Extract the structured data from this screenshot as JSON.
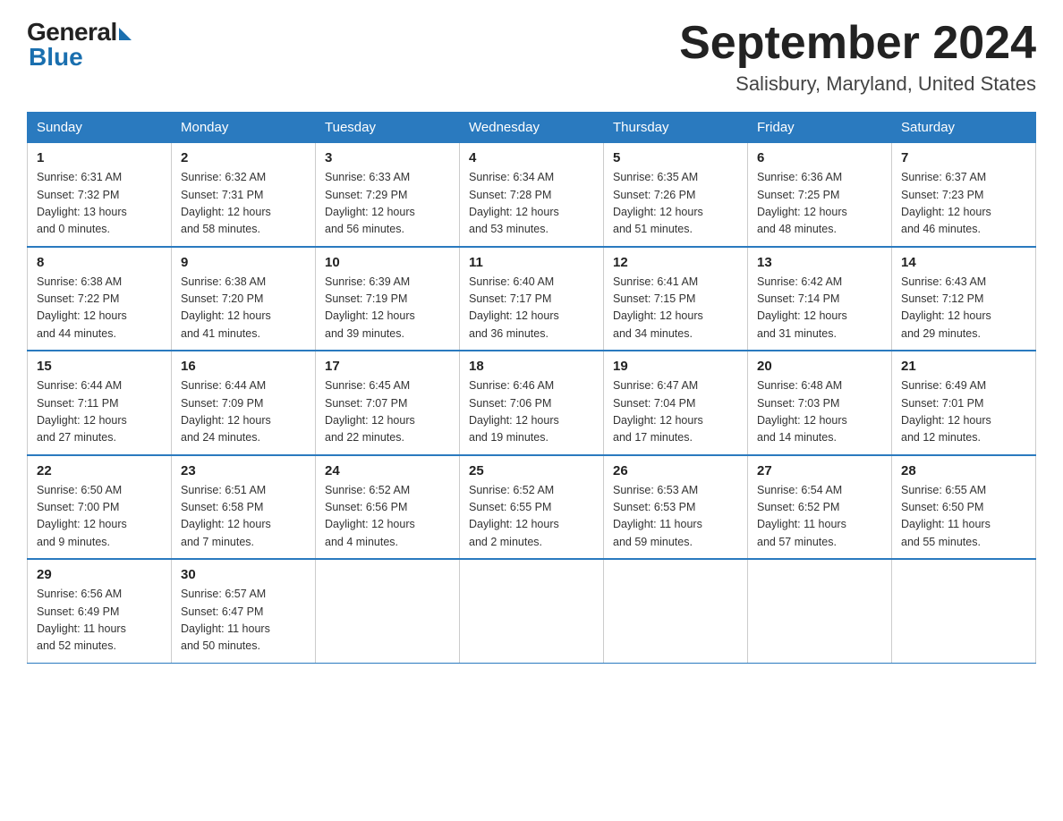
{
  "header": {
    "logo_general": "General",
    "logo_blue": "Blue",
    "title": "September 2024",
    "location": "Salisbury, Maryland, United States"
  },
  "weekdays": [
    "Sunday",
    "Monday",
    "Tuesday",
    "Wednesday",
    "Thursday",
    "Friday",
    "Saturday"
  ],
  "weeks": [
    [
      {
        "day": "1",
        "sunrise": "6:31 AM",
        "sunset": "7:32 PM",
        "daylight": "13 hours and 0 minutes."
      },
      {
        "day": "2",
        "sunrise": "6:32 AM",
        "sunset": "7:31 PM",
        "daylight": "12 hours and 58 minutes."
      },
      {
        "day": "3",
        "sunrise": "6:33 AM",
        "sunset": "7:29 PM",
        "daylight": "12 hours and 56 minutes."
      },
      {
        "day": "4",
        "sunrise": "6:34 AM",
        "sunset": "7:28 PM",
        "daylight": "12 hours and 53 minutes."
      },
      {
        "day": "5",
        "sunrise": "6:35 AM",
        "sunset": "7:26 PM",
        "daylight": "12 hours and 51 minutes."
      },
      {
        "day": "6",
        "sunrise": "6:36 AM",
        "sunset": "7:25 PM",
        "daylight": "12 hours and 48 minutes."
      },
      {
        "day": "7",
        "sunrise": "6:37 AM",
        "sunset": "7:23 PM",
        "daylight": "12 hours and 46 minutes."
      }
    ],
    [
      {
        "day": "8",
        "sunrise": "6:38 AM",
        "sunset": "7:22 PM",
        "daylight": "12 hours and 44 minutes."
      },
      {
        "day": "9",
        "sunrise": "6:38 AM",
        "sunset": "7:20 PM",
        "daylight": "12 hours and 41 minutes."
      },
      {
        "day": "10",
        "sunrise": "6:39 AM",
        "sunset": "7:19 PM",
        "daylight": "12 hours and 39 minutes."
      },
      {
        "day": "11",
        "sunrise": "6:40 AM",
        "sunset": "7:17 PM",
        "daylight": "12 hours and 36 minutes."
      },
      {
        "day": "12",
        "sunrise": "6:41 AM",
        "sunset": "7:15 PM",
        "daylight": "12 hours and 34 minutes."
      },
      {
        "day": "13",
        "sunrise": "6:42 AM",
        "sunset": "7:14 PM",
        "daylight": "12 hours and 31 minutes."
      },
      {
        "day": "14",
        "sunrise": "6:43 AM",
        "sunset": "7:12 PM",
        "daylight": "12 hours and 29 minutes."
      }
    ],
    [
      {
        "day": "15",
        "sunrise": "6:44 AM",
        "sunset": "7:11 PM",
        "daylight": "12 hours and 27 minutes."
      },
      {
        "day": "16",
        "sunrise": "6:44 AM",
        "sunset": "7:09 PM",
        "daylight": "12 hours and 24 minutes."
      },
      {
        "day": "17",
        "sunrise": "6:45 AM",
        "sunset": "7:07 PM",
        "daylight": "12 hours and 22 minutes."
      },
      {
        "day": "18",
        "sunrise": "6:46 AM",
        "sunset": "7:06 PM",
        "daylight": "12 hours and 19 minutes."
      },
      {
        "day": "19",
        "sunrise": "6:47 AM",
        "sunset": "7:04 PM",
        "daylight": "12 hours and 17 minutes."
      },
      {
        "day": "20",
        "sunrise": "6:48 AM",
        "sunset": "7:03 PM",
        "daylight": "12 hours and 14 minutes."
      },
      {
        "day": "21",
        "sunrise": "6:49 AM",
        "sunset": "7:01 PM",
        "daylight": "12 hours and 12 minutes."
      }
    ],
    [
      {
        "day": "22",
        "sunrise": "6:50 AM",
        "sunset": "7:00 PM",
        "daylight": "12 hours and 9 minutes."
      },
      {
        "day": "23",
        "sunrise": "6:51 AM",
        "sunset": "6:58 PM",
        "daylight": "12 hours and 7 minutes."
      },
      {
        "day": "24",
        "sunrise": "6:52 AM",
        "sunset": "6:56 PM",
        "daylight": "12 hours and 4 minutes."
      },
      {
        "day": "25",
        "sunrise": "6:52 AM",
        "sunset": "6:55 PM",
        "daylight": "12 hours and 2 minutes."
      },
      {
        "day": "26",
        "sunrise": "6:53 AM",
        "sunset": "6:53 PM",
        "daylight": "11 hours and 59 minutes."
      },
      {
        "day": "27",
        "sunrise": "6:54 AM",
        "sunset": "6:52 PM",
        "daylight": "11 hours and 57 minutes."
      },
      {
        "day": "28",
        "sunrise": "6:55 AM",
        "sunset": "6:50 PM",
        "daylight": "11 hours and 55 minutes."
      }
    ],
    [
      {
        "day": "29",
        "sunrise": "6:56 AM",
        "sunset": "6:49 PM",
        "daylight": "11 hours and 52 minutes."
      },
      {
        "day": "30",
        "sunrise": "6:57 AM",
        "sunset": "6:47 PM",
        "daylight": "11 hours and 50 minutes."
      },
      null,
      null,
      null,
      null,
      null
    ]
  ],
  "labels": {
    "sunrise": "Sunrise:",
    "sunset": "Sunset:",
    "daylight": "Daylight:"
  }
}
